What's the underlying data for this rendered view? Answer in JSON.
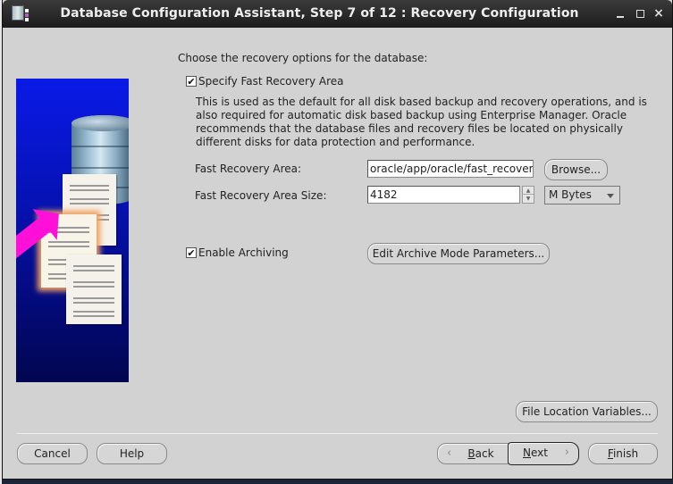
{
  "window": {
    "title": "Database Configuration Assistant, Step 7 of 12 : Recovery Configuration",
    "controls": {
      "minimize": "minimize",
      "maximize": "maximize",
      "close": "×"
    }
  },
  "content": {
    "intro": "Choose the recovery options for the database:",
    "specify_fra": {
      "label": "Specify Fast Recovery Area",
      "checked": true,
      "check_glyph": "✔"
    },
    "description": "This is used as the default for all disk based backup and recovery operations, and is also required for automatic disk based backup using Enterprise Manager. Oracle recommends that the database files and recovery files be located on physically different disks for data protection and performance.",
    "fra_location": {
      "label": "Fast Recovery Area:",
      "value": "oracle/app/oracle/fast_recovery"
    },
    "browse_button": "Browse...",
    "fra_size": {
      "label": "Fast Recovery Area Size:",
      "value": "4182"
    },
    "size_unit": {
      "selected": "M Bytes"
    },
    "enable_archiving": {
      "label": "Enable Archiving",
      "checked": true,
      "check_glyph": "✔"
    },
    "archive_params_button": "Edit Archive Mode Parameters...",
    "file_location_button": "File Location Variables..."
  },
  "footer": {
    "cancel": "Cancel",
    "help": "Help",
    "back": {
      "prefix": "",
      "mnemonic": "B",
      "rest": "ack",
      "icon": "‹"
    },
    "next": {
      "mnemonic": "N",
      "rest": "ext",
      "icon": "›"
    },
    "finish": {
      "mnemonic": "F",
      "rest": "inish"
    }
  }
}
